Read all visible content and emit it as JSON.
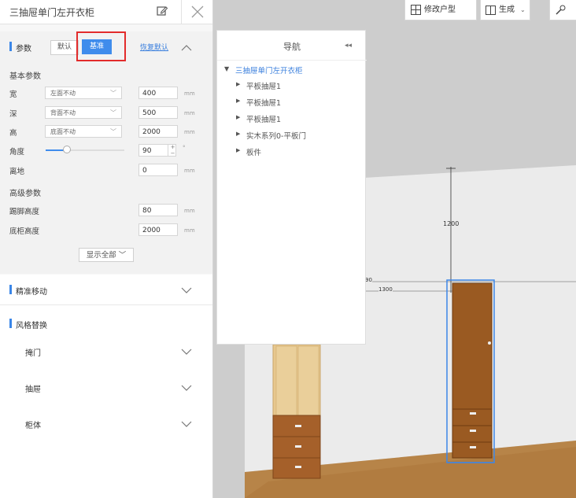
{
  "panel": {
    "title": "三抽屉单门左开衣柜"
  },
  "params": {
    "section_label": "参数",
    "default_label": "默认",
    "base_label": "基准",
    "restore_label": "恢复默认",
    "basic_group": "基本参数",
    "rows": [
      {
        "label": "宽",
        "select": "左面不动",
        "value": "400",
        "unit": "mm"
      },
      {
        "label": "深",
        "select": "背面不动",
        "value": "500",
        "unit": "mm"
      },
      {
        "label": "高",
        "select": "底面不动",
        "value": "2000",
        "unit": "mm"
      }
    ],
    "angle": {
      "label": "角度",
      "value": "90",
      "unit": "°",
      "slider_fraction": 0.27
    },
    "ground": {
      "label": "离地",
      "value": "0",
      "unit": "mm"
    },
    "advanced_group": "高级参数",
    "advanced_rows": [
      {
        "label": "踢脚高度",
        "value": "80",
        "unit": "mm"
      },
      {
        "label": "底柜高度",
        "value": "2000",
        "unit": "mm"
      }
    ],
    "show_all": "显示全部"
  },
  "sections": {
    "precise_move": "精准移动",
    "style_replace": "风格替换",
    "swing_door": "掩门",
    "drawer": "抽屉",
    "cabinet": "柜体"
  },
  "toolbar": {
    "modify_layout": "修改户型",
    "generate": "生成"
  },
  "nav": {
    "title": "导航",
    "root": "三抽屉单门左开衣柜",
    "children": [
      "平板抽屉1",
      "平板抽屉1",
      "平板抽屉1",
      "实木系列0-平板门",
      "板件"
    ]
  },
  "scene": {
    "dim_1200": "1200",
    "dim_1300": "1300",
    "dim_partial": "90"
  },
  "colors": {
    "accent": "#3f8cec",
    "highlight": "#e22b2b",
    "wood_door": "#9a5a22",
    "floor": "#b78448"
  }
}
